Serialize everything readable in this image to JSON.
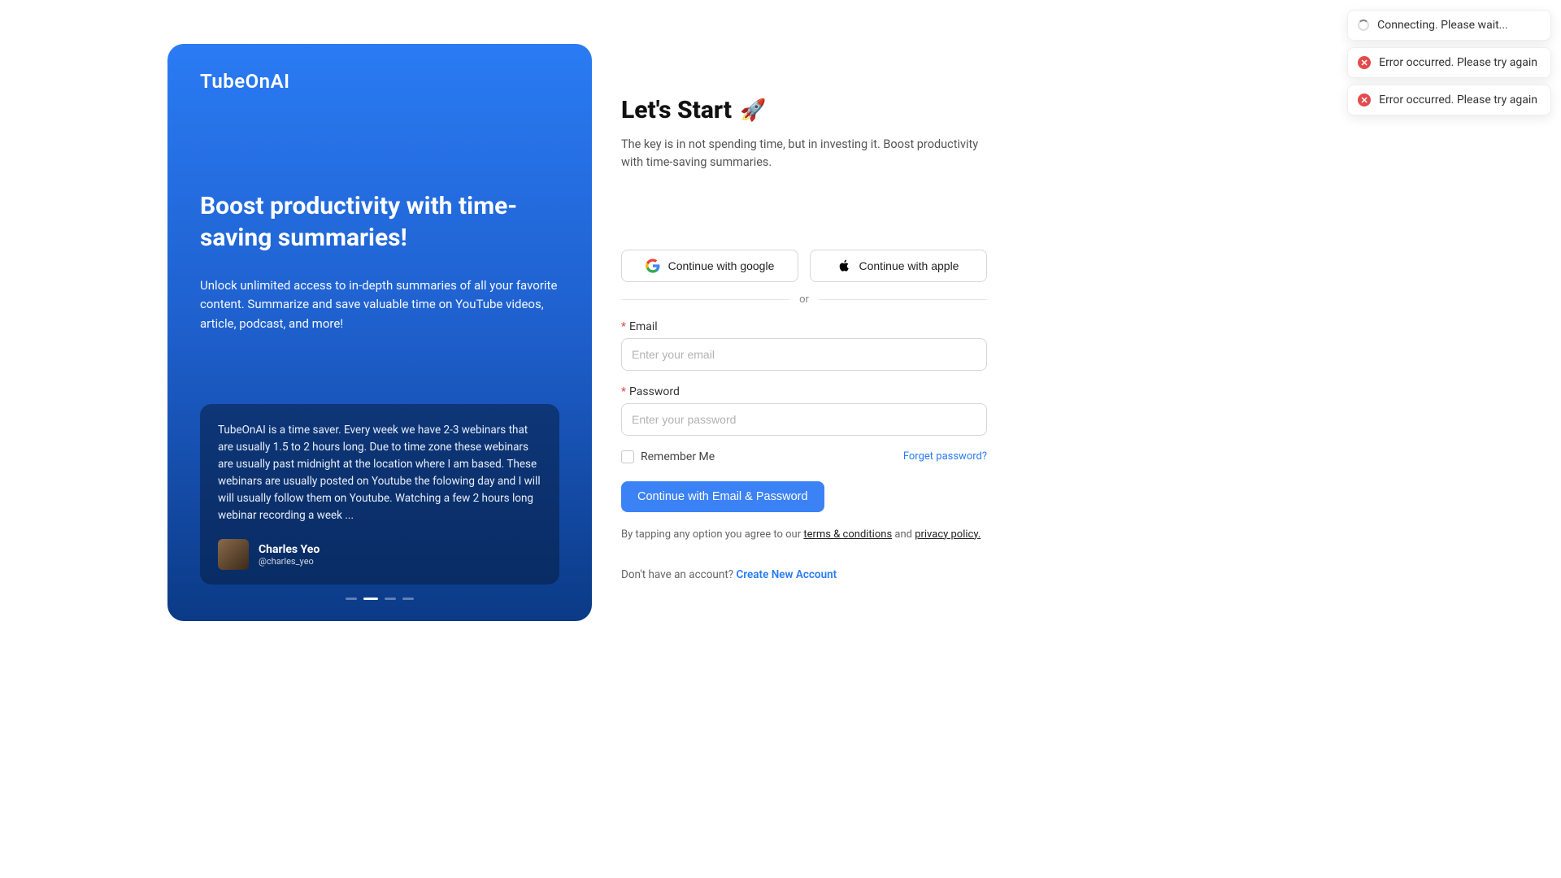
{
  "left": {
    "logo": "TubeOnAI",
    "heading": "Boost productivity with time-saving summaries!",
    "body": "Unlock unlimited access to in-depth summaries of all your favorite content. Summarize and save valuable time on YouTube videos, article, podcast, and more!",
    "testimonial": {
      "text": "TubeOnAI is a time saver. Every week we have 2-3 webinars that are usually 1.5 to 2 hours long. Due to time zone these webinars are usually past midnight at the location where I am based. These webinars are usually posted on Youtube the folowing day and I will will usually follow them on Youtube. Watching a few 2 hours long webinar recording a week ...",
      "author_name": "Charles Yeo",
      "author_handle": "@charles_yeo"
    },
    "active_dot_index": 1,
    "dot_count": 4
  },
  "right": {
    "heading": "Let's Start",
    "rocket": "🚀",
    "sub": "The key is in not spending time, but in investing it. Boost productivity with time-saving summaries.",
    "google_label": "Continue with google",
    "apple_label": "Continue with apple",
    "or": "or",
    "email_label": "Email",
    "email_placeholder": "Enter your email",
    "password_label": "Password",
    "password_placeholder": "Enter your password",
    "remember_label": "Remember Me",
    "forgot_label": "Forget password?",
    "submit_label": "Continue with Email & Password",
    "legal_prefix": "By tapping any option you agree to our ",
    "legal_terms": "terms & conditions",
    "legal_and": " and ",
    "legal_privacy": "privacy policy.",
    "create_prefix": "Don't have an account? ",
    "create_link": "Create New Account"
  },
  "toasts": [
    {
      "type": "loading",
      "text": "Connecting. Please wait..."
    },
    {
      "type": "error",
      "text": "Error occurred. Please try again"
    },
    {
      "type": "error",
      "text": "Error occurred. Please try again"
    }
  ]
}
